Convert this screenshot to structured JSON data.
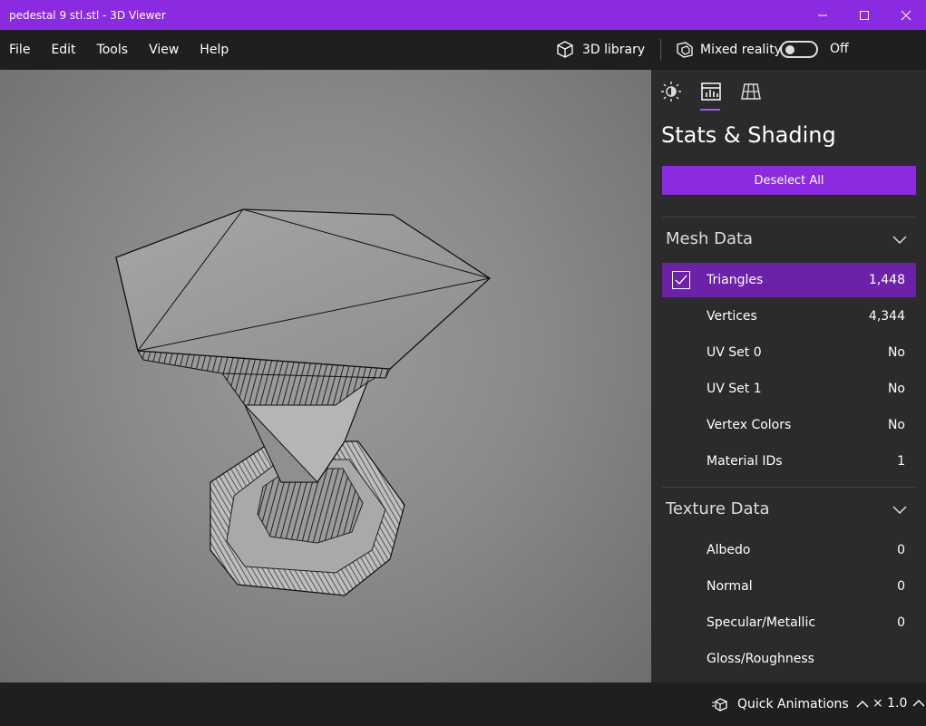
{
  "window": {
    "title": "pedestal 9 stl.stl - 3D Viewer",
    "accent_color": "#8a2be2"
  },
  "menu": {
    "items": [
      {
        "label": "File"
      },
      {
        "label": "Edit"
      },
      {
        "label": "Tools"
      },
      {
        "label": "View"
      },
      {
        "label": "Help"
      }
    ],
    "library_label": "3D library",
    "mixed_reality_label": "Mixed reality",
    "mixed_reality_state": "Off"
  },
  "panel": {
    "title": "Stats & Shading",
    "deselect_label": "Deselect All",
    "mesh_section": "Mesh Data",
    "mesh_rows": [
      {
        "label": "Triangles",
        "value": "1,448",
        "checked": true
      },
      {
        "label": "Vertices",
        "value": "4,344"
      },
      {
        "label": "UV Set 0",
        "value": "No"
      },
      {
        "label": "UV Set 1",
        "value": "No"
      },
      {
        "label": "Vertex Colors",
        "value": "No"
      },
      {
        "label": "Material IDs",
        "value": "1"
      }
    ],
    "texture_section": "Texture Data",
    "texture_rows": [
      {
        "label": "Albedo",
        "value": "0"
      },
      {
        "label": "Normal",
        "value": "0"
      },
      {
        "label": "Specular/Metallic",
        "value": "0"
      },
      {
        "label": "Gloss/Roughness",
        "value": ""
      }
    ]
  },
  "bottom": {
    "quick_animations": "Quick Animations",
    "speed": "× 1.0"
  }
}
